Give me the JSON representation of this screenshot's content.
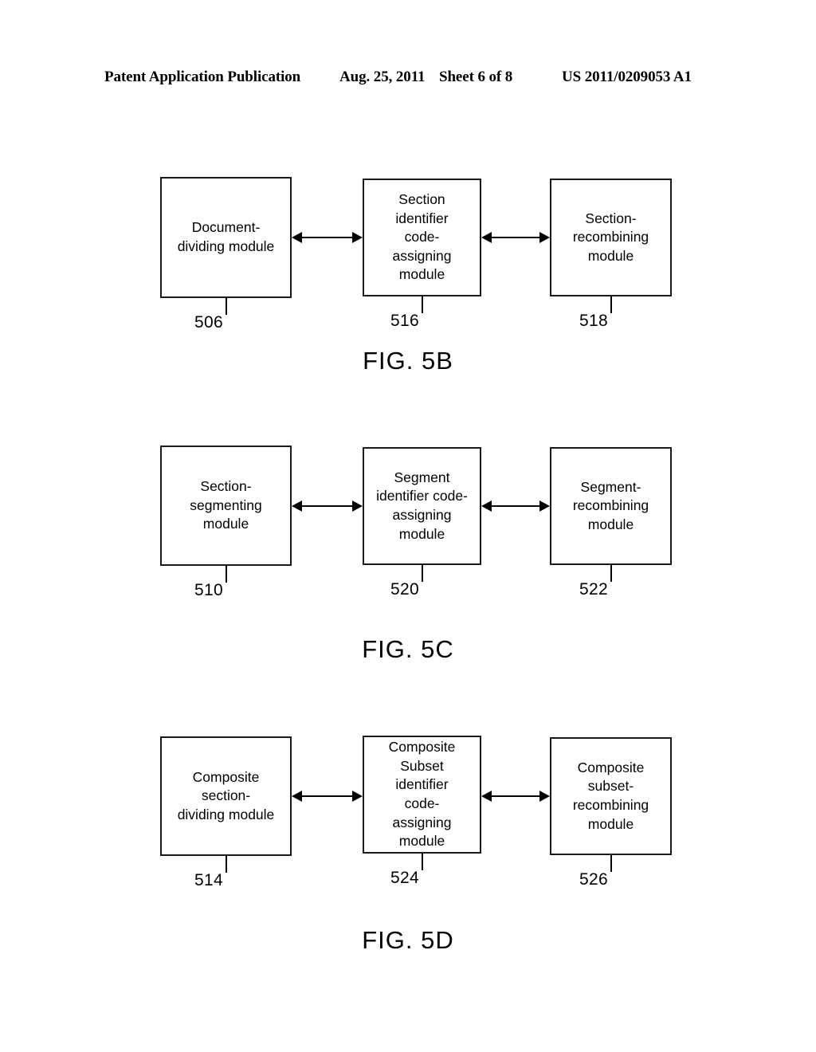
{
  "header": {
    "publication": "Patent Application Publication",
    "date": "Aug. 25, 2011",
    "sheet": "Sheet 6 of 8",
    "patent_number": "US 2011/0209053 A1"
  },
  "figures": [
    {
      "caption": "FIG. 5B",
      "boxes": [
        {
          "label": "Document-\ndividing module",
          "ref": "506"
        },
        {
          "label": "Section\nidentifier\ncode-\nassigning\nmodule",
          "ref": "516"
        },
        {
          "label": "Section-\nrecombining\nmodule",
          "ref": "518"
        }
      ],
      "connectors": [
        {
          "name": "arrow-left-middle",
          "style": "double-headed"
        },
        {
          "name": "arrow-middle-right",
          "style": "double-headed"
        }
      ]
    },
    {
      "caption": "FIG. 5C",
      "boxes": [
        {
          "label": "Section-\nsegmenting\nmodule",
          "ref": "510"
        },
        {
          "label": "Segment\nidentifier code-\nassigning\nmodule",
          "ref": "520"
        },
        {
          "label": "Segment-\nrecombining\nmodule",
          "ref": "522"
        }
      ],
      "connectors": [
        {
          "name": "arrow-left-middle",
          "style": "double-headed"
        },
        {
          "name": "arrow-middle-right",
          "style": "double-headed"
        }
      ]
    },
    {
      "caption": "FIG. 5D",
      "boxes": [
        {
          "label": "Composite\nsection-\ndividing module",
          "ref": "514"
        },
        {
          "label": "Composite\nSubset\nidentifier\ncode-\nassigning\nmodule",
          "ref": "524"
        },
        {
          "label": "Composite\nsubset-\nrecombining\nmodule",
          "ref": "526"
        }
      ],
      "connectors": [
        {
          "name": "arrow-left-middle",
          "style": "double-headed"
        },
        {
          "name": "arrow-middle-right",
          "style": "double-headed"
        }
      ]
    }
  ],
  "colors": {
    "ink": "#000000",
    "box_border": "#1a1a1a",
    "page_background": "#ffffff"
  }
}
